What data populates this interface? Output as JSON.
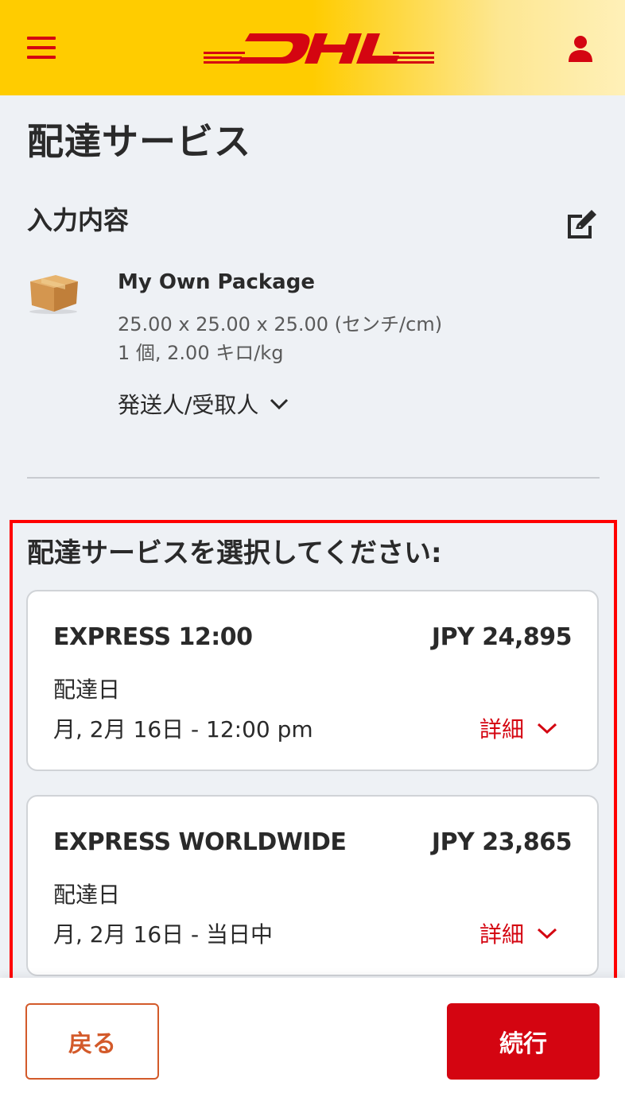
{
  "brand": {
    "logo_text": "DHL",
    "primary_color": "#d40511",
    "header_color": "#ffcc00"
  },
  "header": {
    "menu_icon": "hamburger-icon",
    "user_icon": "user-icon"
  },
  "page_title": "配達サービス",
  "summary": {
    "title": "入力内容",
    "edit_icon": "edit-icon",
    "package": {
      "icon": "box-icon",
      "name": "My Own Package",
      "dimensions": "25.00 x 25.00 x 25.00 (センチ/cm)",
      "quantity_weight": "1 個, 2.00 キロ/kg"
    },
    "shipper_receiver_label": "発送人/受取人"
  },
  "services": {
    "title": "配達サービスを選択してください:",
    "options": [
      {
        "name": "EXPRESS 12:00",
        "price": "JPY 24,895",
        "delivery_label": "配達日",
        "delivery_date": "月, 2月 16日 - 12:00 pm",
        "details_label": "詳細"
      },
      {
        "name": "EXPRESS WORLDWIDE",
        "price": "JPY 23,865",
        "delivery_label": "配達日",
        "delivery_date": "月, 2月 16日 - 当日中",
        "details_label": "詳細"
      }
    ]
  },
  "footer": {
    "back_label": "戻る",
    "continue_label": "続行"
  }
}
